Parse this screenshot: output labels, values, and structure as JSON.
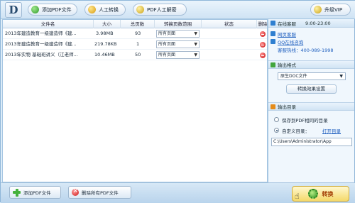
{
  "toolbar": {
    "logo": "D",
    "add_pdf": "添加PDF文件",
    "manual_convert": "人工转换",
    "pdf_manual_decrypt": "PDF人工解密",
    "upgrade_vip": "升级VIP"
  },
  "table": {
    "columns": [
      "文件名",
      "大小",
      "总页数",
      "转换页数范围",
      "状态",
      "删除"
    ],
    "rows": [
      {
        "name": "2013年建造教育一级建造师《建...",
        "size": "3.98MB",
        "pages": "93",
        "range": "所有页面",
        "status": ""
      },
      {
        "name": "2013年建造教育一级建造师《建...",
        "size": "219.78KB",
        "pages": "1",
        "range": "所有页面",
        "status": ""
      },
      {
        "name": "2013年实物 基础班讲义（江老师...",
        "size": "10.46MB",
        "pages": "50",
        "range": "所有页面",
        "status": ""
      }
    ]
  },
  "sidebar": {
    "service": {
      "title": "在线客服",
      "hours": "9:00-23:00",
      "web_service": "网页客服",
      "qq_service": "QQ在线咨询",
      "hotline": "客服热线：400-089-1998"
    },
    "output_format": {
      "title": "输出格式",
      "selected": "原生DOC文件",
      "effect_button": "转换效果设置"
    },
    "output_dir": {
      "title": "输出目录",
      "option_same": "保存到PDF相同的目录",
      "option_custom": "自定义目录：",
      "open_dir": "打开目录",
      "path": "C:\\Users\\Administrator\\App"
    }
  },
  "bottom": {
    "add_pdf": "添加PDF文件",
    "remove_all": "删除所有PDF文件",
    "convert": "转换"
  }
}
